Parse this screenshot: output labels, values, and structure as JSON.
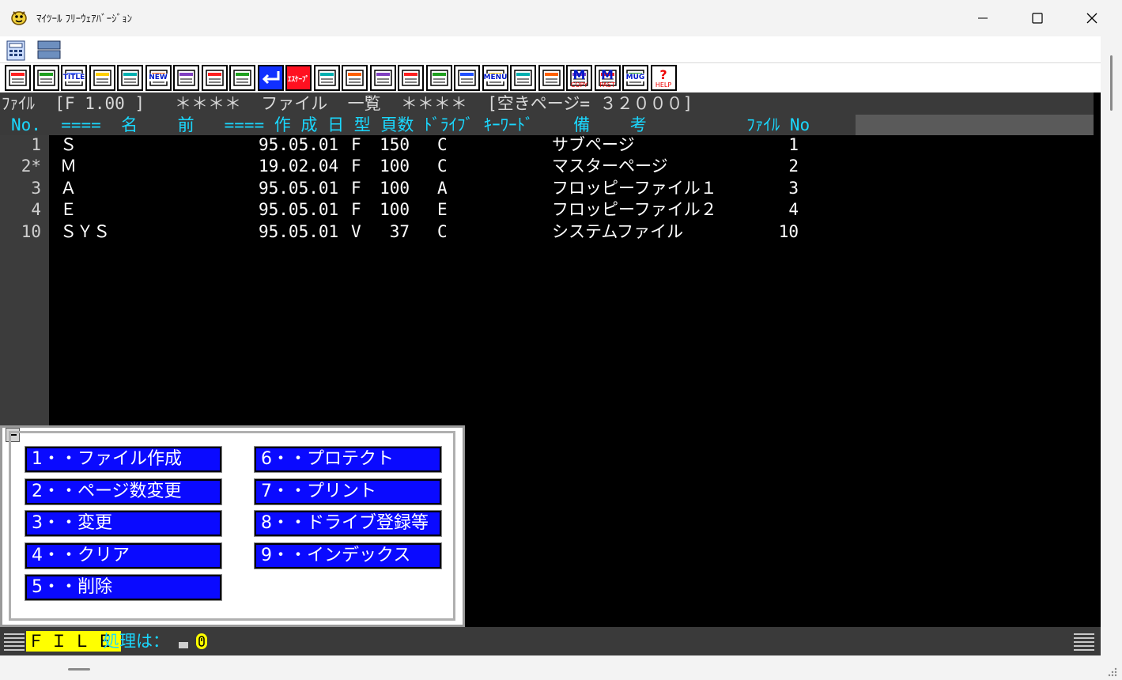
{
  "window": {
    "title": "ﾏｲﾂｰﾙ ﾌﾘｰｳｪｱﾊﾞｰｼﾞｮﾝ",
    "icon": "mytool-app-icon",
    "controls": [
      "minimize-icon",
      "maximize-icon",
      "close-icon"
    ]
  },
  "toolbar": {
    "buttons": [
      {
        "icon": "window-icon",
        "label": ""
      },
      {
        "icon": "color-palette-icon",
        "label": ""
      },
      {
        "icon": "title-icon",
        "label": "TITLE"
      },
      {
        "icon": "page-icon",
        "label": ""
      },
      {
        "icon": "copy-pages-icon",
        "label": ""
      },
      {
        "icon": "new-icon",
        "label": "NEW"
      },
      {
        "icon": "folder-icon",
        "label": ""
      },
      {
        "icon": "printer-icon",
        "label": ""
      },
      {
        "icon": "printer-cancel-icon",
        "label": ""
      },
      {
        "icon": "enter-icon",
        "label": ""
      },
      {
        "icon": "escape-icon",
        "label": "ｴｽｹｰﾌﾟ"
      },
      {
        "icon": "eraser-icon",
        "label": ""
      },
      {
        "icon": "layout-icon",
        "label": ""
      },
      {
        "icon": "transfer-icon",
        "label": ""
      },
      {
        "icon": "export-icon",
        "label": ""
      },
      {
        "icon": "pencil-icon",
        "label": ""
      },
      {
        "icon": "speaker-icon",
        "label": ""
      },
      {
        "icon": "menu-book-icon",
        "label": "MENU"
      },
      {
        "icon": "list-icon",
        "label": ""
      },
      {
        "icon": "screen-icon",
        "label": ""
      },
      {
        "icon": "m-copy-icon",
        "label": "M",
        "sub": "COPY"
      },
      {
        "icon": "m-paste-icon",
        "label": "M",
        "sub": "PAST"
      },
      {
        "icon": "mug-icon",
        "label": "MUG"
      },
      {
        "icon": "help-icon",
        "label": "?",
        "sub": "HELP"
      }
    ]
  },
  "header": {
    "line1": "ﾌｧｲﾙ  [F 1.00 ]   ＊＊＊＊  ファイル  一覧  ＊＊＊＊  [空きページ= ３２０００]",
    "line2": "No.  ====  名    前   ==== 作 成 日 型 頁数 ﾄﾞﾗｲﾌﾞ ｷｰﾜｰﾄﾞ    備    考          ﾌｧｲﾙ No"
  },
  "files": [
    {
      "no": "1",
      "name": "Ｓ",
      "date": "95.05.01",
      "type": "F",
      "pages": "150",
      "drive": "C",
      "note": "サブページ",
      "file_no": "1"
    },
    {
      "no": "2*",
      "name": "Ｍ",
      "date": "19.02.04",
      "type": "F",
      "pages": "100",
      "drive": "C",
      "note": "マスターページ",
      "file_no": "2"
    },
    {
      "no": "3",
      "name": "Ａ",
      "date": "95.05.01",
      "type": "F",
      "pages": "100",
      "drive": "A",
      "note": "フロッピーファイル１",
      "file_no": "3"
    },
    {
      "no": "4",
      "name": "Ｅ",
      "date": "95.05.01",
      "type": "F",
      "pages": "100",
      "drive": "E",
      "note": "フロッピーファイル２",
      "file_no": "4"
    },
    {
      "no": "10",
      "name": "ＳＹＳ",
      "date": "95.05.01",
      "type": "V",
      "pages": "37",
      "drive": "C",
      "note": "システムファイル",
      "file_no": "10"
    }
  ],
  "menu": {
    "items": [
      "1・・ファイル作成",
      "2・・ページ数変更",
      "3・・変更",
      "4・・クリア",
      "5・・削除",
      "6・・プロテクト",
      "7・・プリント",
      "8・・ドライブ登録等",
      "9・・インデックス"
    ]
  },
  "status": {
    "mode": "ＦＩＬＥ",
    "prompt": "処理は：",
    "caps_icon": "caps-indicator-icon"
  },
  "colors": {
    "terminal_bg": "#000000",
    "cyan_text": "#1ad8ff",
    "menu_button": "#0a0aff",
    "status_yellow": "#ffff00"
  }
}
